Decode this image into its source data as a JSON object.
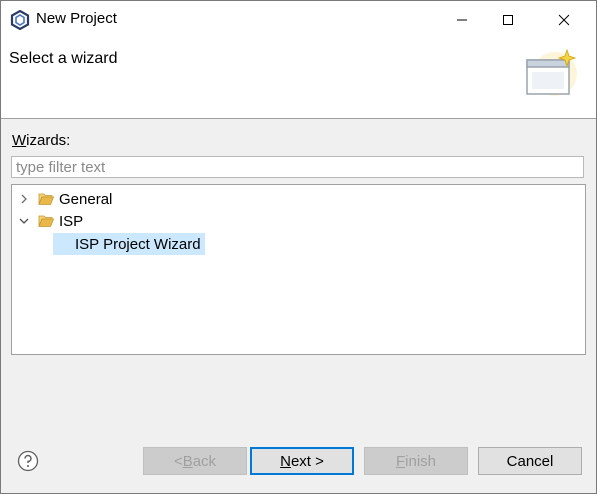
{
  "window": {
    "title": "New Project"
  },
  "banner": {
    "title": "Select a wizard"
  },
  "wizards": {
    "label_mnemonic": "W",
    "label_rest": "izards:",
    "filter_placeholder": "type filter text",
    "tree": [
      {
        "label": "General",
        "expanded": false
      },
      {
        "label": "ISP",
        "expanded": true,
        "children": [
          {
            "label": "ISP Project Wizard",
            "selected": true
          }
        ]
      }
    ]
  },
  "buttons": {
    "back_pre": "< ",
    "back_mn": "B",
    "back_post": "ack",
    "next_mn": "N",
    "next_post": "ext >",
    "finish_mn": "F",
    "finish_post": "inish",
    "cancel": "Cancel"
  },
  "colors": {
    "selection": "#cce8ff",
    "default_button_border": "#0078d7",
    "folder": "#e8b84a"
  }
}
